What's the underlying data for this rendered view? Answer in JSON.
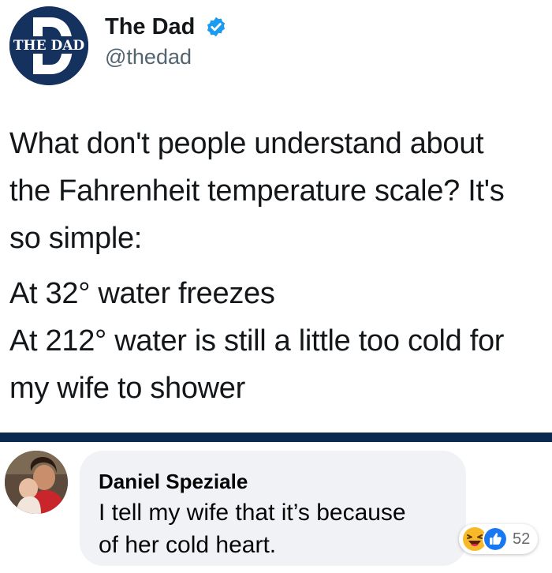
{
  "tweet": {
    "author": {
      "avatar_text": "THE DAD",
      "avatar_letter": "D",
      "name": "The Dad",
      "handle": "@thedad",
      "verified": true
    },
    "text_lines": [
      "What don't people understand about",
      "the Fahrenheit temperature scale? It's",
      "so simple:"
    ],
    "text_lines_2": [
      "At 32° water freezes",
      "At 212° water is still a little too cold for",
      "my wife to shower"
    ]
  },
  "comment": {
    "author_name": "Daniel Speziale",
    "text_lines": [
      "I tell my wife that it’s because",
      "of her cold heart."
    ],
    "reactions": {
      "types": [
        "haha-icon",
        "like-icon"
      ],
      "count": "52"
    }
  },
  "colors": {
    "divider": "#0c2a4f",
    "verified": "#1d9bf0",
    "avatar_bg": "#15325f",
    "comment_bubble": "#f0f2f5",
    "like_blue": "#1877f2",
    "haha_yellow": "#f7b928"
  }
}
